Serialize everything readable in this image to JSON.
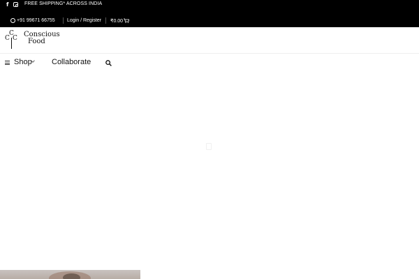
{
  "topbar": {
    "shipping_text": "FREE SHIPPING* ACROSS INDIA",
    "phone": "+91 99671 66755",
    "login_label": "Login / Register",
    "cart_amount": "₹0.00",
    "background": "#000000"
  },
  "logo": {
    "line1": "Conscious",
    "line2": "Food",
    "mark_c1": "C",
    "mark_c2": "C",
    "mark_c3": "C"
  },
  "nav": {
    "shop_label": "Shop",
    "collaborate_label": "Collaborate"
  },
  "icons": [
    "facebook-icon",
    "instagram-icon",
    "whatsapp-icon",
    "cart-icon",
    "menu-icon",
    "search-icon",
    "chevron-down-icon"
  ]
}
